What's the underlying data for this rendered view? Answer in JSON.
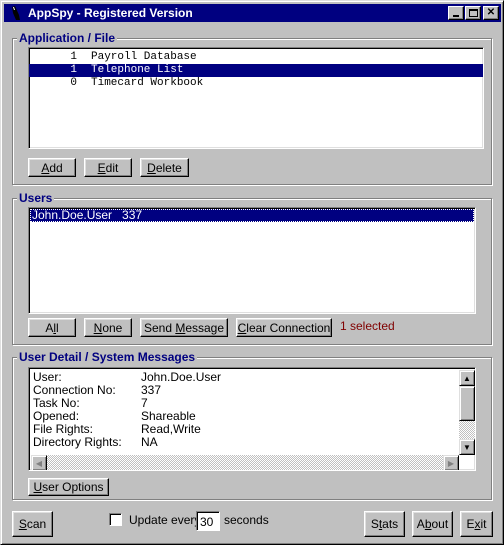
{
  "window": {
    "title": "AppSpy - Registered Version",
    "controls": [
      "minimize-icon",
      "maximize-icon",
      "close-icon"
    ]
  },
  "app_file": {
    "legend": "Application / File",
    "items": [
      {
        "count": "1",
        "name": "Payroll Database",
        "selected": false
      },
      {
        "count": "1",
        "name": "Telephone List",
        "selected": true
      },
      {
        "count": "0",
        "name": "Timecard Workbook",
        "selected": false
      }
    ],
    "buttons": {
      "add": "Add",
      "edit": "Edit",
      "delete": "Delete"
    }
  },
  "users": {
    "legend": "Users",
    "items": [
      {
        "label": "John.Doe.User   337",
        "selected": true
      }
    ],
    "buttons": {
      "all": "All",
      "none": "None",
      "send_message": "Send Message",
      "clear_connection": "Clear Connection"
    },
    "status": "1 selected"
  },
  "detail": {
    "legend": "User Detail / System Messages",
    "rows": [
      {
        "key": "User:",
        "value": "John.Doe.User"
      },
      {
        "key": "Connection No:",
        "value": "337"
      },
      {
        "key": "Task No:",
        "value": "7"
      },
      {
        "key": "Opened:",
        "value": "Shareable"
      },
      {
        "key": "File Rights:",
        "value": "Read,Write"
      },
      {
        "key": "Directory Rights:",
        "value": "NA"
      }
    ],
    "user_options": "User Options"
  },
  "footer": {
    "scan": "Scan",
    "update_label": "Update every",
    "update_checked": false,
    "interval": "30",
    "seconds_label": "seconds",
    "stats": "Stats",
    "about": "About",
    "exit": "Exit"
  }
}
